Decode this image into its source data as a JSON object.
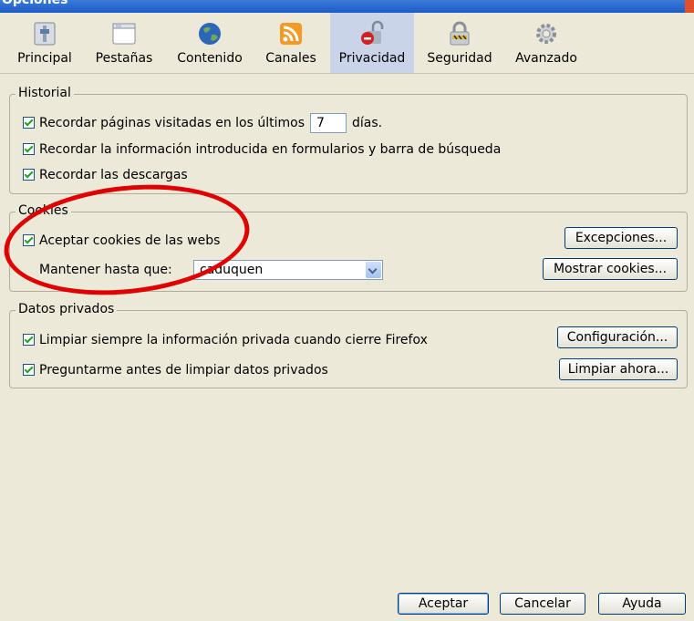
{
  "window": {
    "title": "Opciones"
  },
  "tabs": [
    {
      "label": "Principal",
      "icon": "switch-icon"
    },
    {
      "label": "Pestañas",
      "icon": "window-tabs-icon"
    },
    {
      "label": "Contenido",
      "icon": "globe-icon"
    },
    {
      "label": "Canales",
      "icon": "rss-feed-icon"
    },
    {
      "label": "Privacidad",
      "icon": "privacy-mask-icon",
      "selected": true
    },
    {
      "label": "Seguridad",
      "icon": "padlock-icon"
    },
    {
      "label": "Avanzado",
      "icon": "gear-icon"
    }
  ],
  "historial": {
    "legend": "Historial",
    "remember_pages_before": "Recordar páginas visitadas en los últimos",
    "days_value": "7",
    "days_unit": "días.",
    "remember_forms": "Recordar la información introducida en formularios y barra de búsqueda",
    "remember_downloads": "Recordar las descargas"
  },
  "cookies": {
    "legend": "Cookies",
    "accept_cookies": "Aceptar cookies de las webs",
    "keep_until_label": "Mantener hasta que:",
    "keep_until_value": "caduquen",
    "exceptions_button": "Excepciones...",
    "show_cookies_button": "Mostrar cookies..."
  },
  "datos_privados": {
    "legend": "Datos privados",
    "always_clear": "Limpiar siempre la información privada cuando cierre Firefox",
    "ask_before": "Preguntarme antes de limpiar datos privados",
    "settings_button": "Configuración...",
    "clear_now_button": "Limpiar ahora..."
  },
  "footer": {
    "accept": "Aceptar",
    "cancel": "Cancelar",
    "help": "Ayuda"
  },
  "colors": {
    "annotation_circle": "#e00000",
    "selected_tab_bg": "#c9d4e8",
    "dialog_bg": "#ece9d8"
  }
}
